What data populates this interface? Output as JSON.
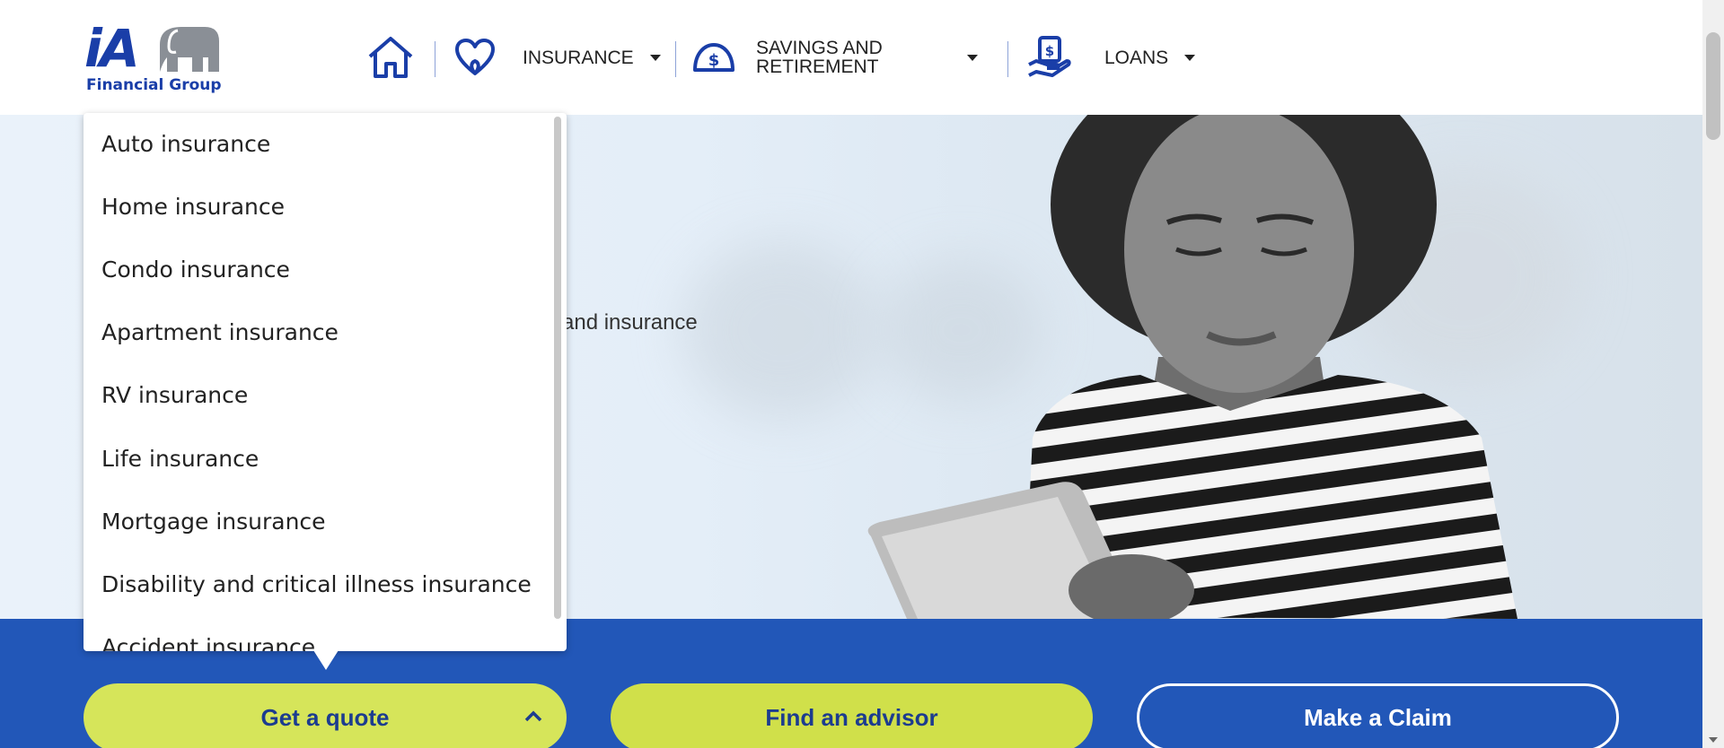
{
  "header": {
    "logo_main": "iA",
    "logo_sub": "Financial Group",
    "nav": [
      {
        "icon": "home-icon",
        "label": ""
      },
      {
        "icon": "heart-icon",
        "label": "INSURANCE"
      },
      {
        "icon": "savings-icon",
        "label_line1": "SAVINGS AND",
        "label_line2": "RETIREMENT"
      },
      {
        "icon": "loan-hand-icon",
        "label": "LOANS"
      }
    ]
  },
  "hero": {
    "partial_text": "and insurance"
  },
  "dropdown": {
    "items": [
      "Auto insurance",
      "Home insurance",
      "Condo insurance",
      "Apartment insurance",
      "RV insurance",
      "Life insurance",
      "Mortgage insurance",
      "Disability and critical illness insurance",
      "Accident insurance"
    ]
  },
  "cta": {
    "quote": "Get a quote",
    "advisor": "Find an advisor",
    "claim": "Make a Claim"
  },
  "colors": {
    "brand_blue": "#1a3ea8",
    "band_blue": "#2257b8",
    "lime": "#d6e55a"
  }
}
